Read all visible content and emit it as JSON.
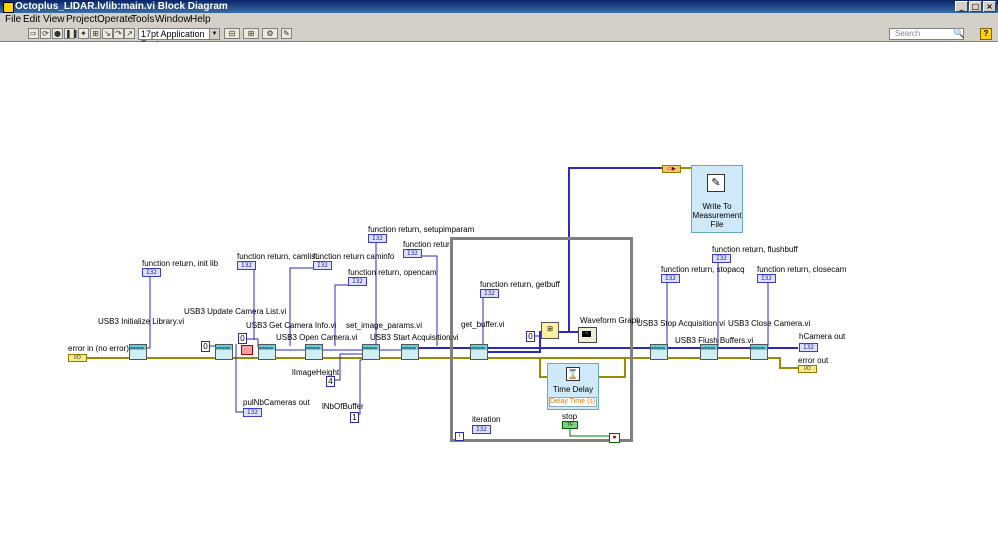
{
  "window": {
    "title": "Octoplus_LIDAR.lvlib:main.vi Block Diagram",
    "buttons": [
      "_",
      "□",
      "×"
    ]
  },
  "menu": [
    "File",
    "Edit",
    "View",
    "Project",
    "Operate",
    "Tools",
    "Window",
    "Help"
  ],
  "toolbar": {
    "font": "17pt Application Font",
    "search_placeholder": "Search",
    "help_label": "?"
  },
  "diagram": {
    "nodes": {
      "usb3_init_library": "USB3 Initialize Library.vi",
      "usb3_update_camera_list": "USB3 Update Camera List.vi",
      "usb3_get_camera_info": "USB3 Get Camera Info.vi",
      "usb3_open_camera": "USB3 Open Camera.vi",
      "set_image_params": "set_image_params.vi",
      "usb3_start_acquisition": "USB3 Start Acquisition.vi",
      "get_buffer": "get_buffer.vi",
      "waveform_graph": "Waveform Graph",
      "time_delay": "Time Delay",
      "time_delay_terminal": "Delay Time (s)",
      "write_measurement_file": "Write To Measurement File",
      "usb3_stop_acquisition": "USB3 Stop Acquisition.vi",
      "usb3_flush_buffers": "USB3 Flush Buffers.vi",
      "usb3_close_camera": "USB3 Close Camera.vi"
    },
    "labels": {
      "fr_init_lib": "function return, init lib",
      "fr_camlist": "function return, camlist",
      "fr_caminfo": "function return caminfo",
      "fr_opencam": "function return, opencam",
      "fr_setupimparam": "function return, setupimparam",
      "fr_start": "function retur",
      "fr_getbuff": "function return, getbuff",
      "fr_stopacq": "function return, stopacq",
      "fr_flushbuff": "function return, flushbuff",
      "fr_closecam": "function return, closecam",
      "error_in": "error in (no error)",
      "error_out": "error out",
      "hcamera_out": "hCamera out",
      "pulnb_cameras_out": "pulNbCameras out",
      "limage_height": "lImageHeight",
      "lnb_of_buffer": "lNbOfBuffer",
      "iteration": "iteration",
      "stop": "stop"
    },
    "indicator_text": "I32",
    "constants": {
      "c0_a": "0",
      "c0_b": "0",
      "c4": "4",
      "c1": "1",
      "c0_c": "0",
      "iter_i": "i"
    },
    "stop_const": "TF",
    "error_in_term": "I/O",
    "error_out_term": "I/O",
    "subvi_badge": "octopus"
  },
  "colors": {
    "error_wire": "#9c8a00",
    "int_wire": "#2a2ac0",
    "bool_wire": "#007a00",
    "loop_border": "#808080"
  }
}
